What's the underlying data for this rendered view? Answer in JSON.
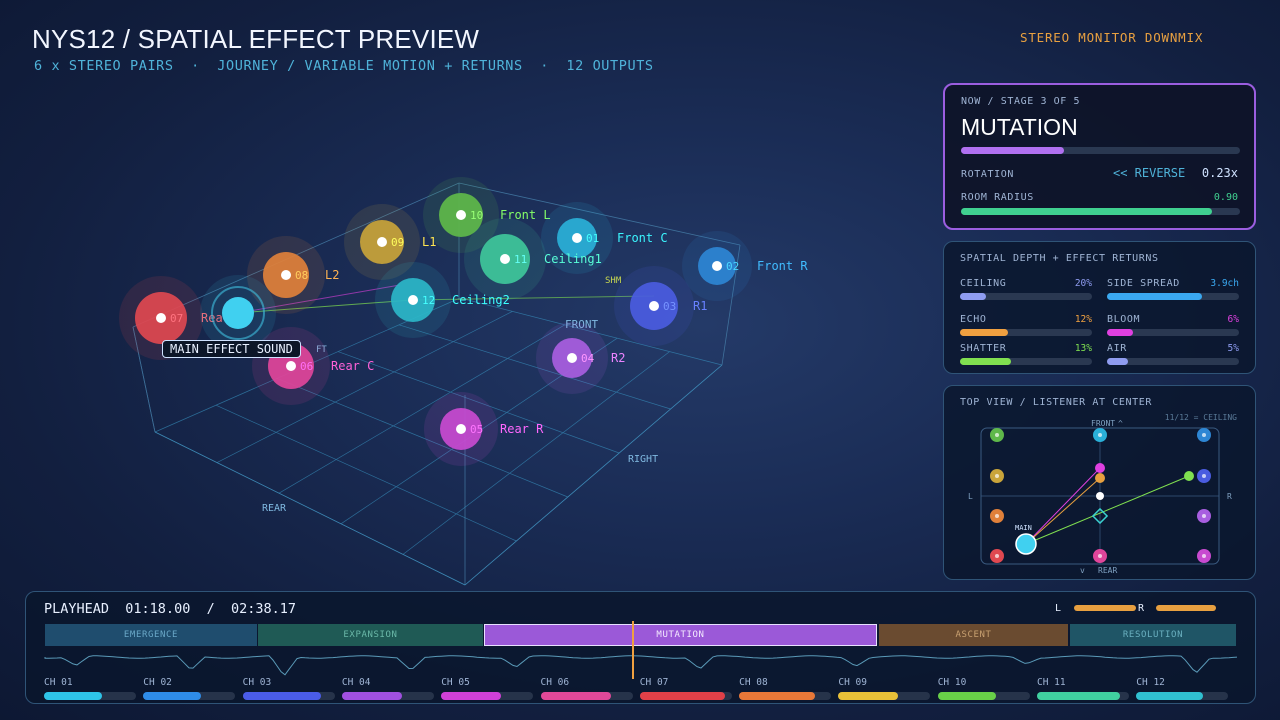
{
  "header": {
    "title": "NYS12 / SPATIAL EFFECT PREVIEW",
    "subtitle": "6 x STEREO PAIRS  ·  JOURNEY / VARIABLE MOTION + RETURNS  ·  12 OUTPUTS",
    "stereo_monitor": "STEREO MONITOR DOWNMIX"
  },
  "scene": {
    "labels": {
      "front": "FRONT",
      "right": "RIGHT",
      "rear": "REAR",
      "left_partial": "FT",
      "shm_partial": "SHM"
    },
    "main_effect_label": "MAIN EFFECT SOUND",
    "nodes": [
      {
        "num": "10",
        "name": "Front L",
        "color": "#5fb84a"
      },
      {
        "num": "01",
        "name": "Front C",
        "color": "#2ab0d8"
      },
      {
        "num": "02",
        "name": "Front R",
        "color": "#2e86d4"
      },
      {
        "num": "09",
        "name": "L1",
        "color": "#c9a43a"
      },
      {
        "num": "08",
        "name": "L2",
        "color": "#e0803a"
      },
      {
        "num": "11",
        "name": "Ceiling1",
        "color": "#3fc79a"
      },
      {
        "num": "12",
        "name": "Ceiling2",
        "color": "#2bb6c8"
      },
      {
        "num": "03",
        "name": "R1",
        "color": "#4a5ce0"
      },
      {
        "num": "07",
        "name": "Rea",
        "color": "#e04850"
      },
      {
        "num": "06",
        "name": "Rear C",
        "color": "#e0459a"
      },
      {
        "num": "04",
        "name": "R2",
        "color": "#a85ee0"
      },
      {
        "num": "05",
        "name": "Rear R",
        "color": "#c84ad0"
      }
    ]
  },
  "now": {
    "crumb": "NOW  /  STAGE 3 OF 5",
    "stage_name": "MUTATION",
    "stage_progress": 0.37,
    "rotation_label": "ROTATION",
    "rotation_dir": "<< REVERSE",
    "rotation_value": "0.23x",
    "radius_label": "ROOM RADIUS",
    "radius_value": "0.90",
    "radius_level": 0.9
  },
  "depth": {
    "title": "SPATIAL DEPTH + EFFECT RETURNS",
    "items": [
      {
        "label": "CEILING",
        "value": "20%",
        "level": 0.2,
        "color": "#8f9cf0"
      },
      {
        "label": "SIDE SPREAD",
        "value": "3.9ch",
        "level": 0.72,
        "color": "#3aa8f0"
      },
      {
        "label": "ECHO",
        "value": "12%",
        "level": 0.36,
        "color": "#f0a040"
      },
      {
        "label": "BLOOM",
        "value": "6%",
        "level": 0.2,
        "color": "#e040e0"
      },
      {
        "label": "SHATTER",
        "value": "13%",
        "level": 0.39,
        "color": "#80e050"
      },
      {
        "label": "AIR",
        "value": "5%",
        "level": 0.16,
        "color": "#8f9cf0"
      }
    ]
  },
  "top_view": {
    "title": "TOP VIEW  /  LISTENER AT CENTER",
    "note": "11/12 = CEILING",
    "front": "FRONT",
    "rear": "REAR",
    "left": "L",
    "right": "R",
    "main": "MAIN",
    "up_mark": "^",
    "down_mark": "v"
  },
  "timeline": {
    "playhead_label": "PLAYHEAD",
    "current": "01:18.00",
    "separator": "/",
    "total": "02:38.17",
    "meter_l": "L",
    "meter_r": "R",
    "meter_l_level": 0.45,
    "meter_r_level": 0.45,
    "segments": [
      {
        "label": "EMERGENCE",
        "bg": "#1f4d6e",
        "fg": "#6aa8c8"
      },
      {
        "label": "EXPANSION",
        "bg": "#1f5a55",
        "fg": "#6ab8a8"
      },
      {
        "label": "MUTATION",
        "bg": "#9b59d8",
        "fg": "#f4eaff"
      },
      {
        "label": "ASCENT",
        "bg": "#6a4b30",
        "fg": "#c8a070"
      },
      {
        "label": "RESOLUTION",
        "bg": "#1f5566",
        "fg": "#6ab0c0"
      }
    ],
    "channels": [
      {
        "label": "CH 01",
        "level": 0.63,
        "color": "#2ec4e8"
      },
      {
        "label": "CH 02",
        "level": 0.63,
        "color": "#2e8ce8"
      },
      {
        "label": "CH 03",
        "level": 0.85,
        "color": "#4a5ce8"
      },
      {
        "label": "CH 04",
        "level": 0.65,
        "color": "#a050e0"
      },
      {
        "label": "CH 05",
        "level": 0.65,
        "color": "#d040d8"
      },
      {
        "label": "CH 06",
        "level": 0.77,
        "color": "#e04898"
      },
      {
        "label": "CH 07",
        "level": 0.93,
        "color": "#e04048"
      },
      {
        "label": "CH 08",
        "level": 0.82,
        "color": "#e87838"
      },
      {
        "label": "CH 09",
        "level": 0.65,
        "color": "#e8c038"
      },
      {
        "label": "CH 10",
        "level": 0.63,
        "color": "#68d048"
      },
      {
        "label": "CH 11",
        "level": 0.9,
        "color": "#40d0a0"
      },
      {
        "label": "CH 12",
        "level": 0.72,
        "color": "#30c0d0"
      }
    ]
  }
}
